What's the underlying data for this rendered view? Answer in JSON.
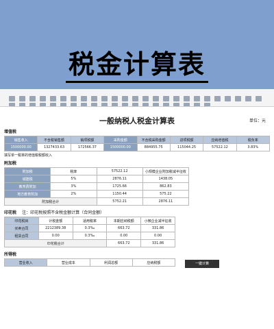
{
  "banner_title": "税金计算表",
  "sheet": {
    "title": "一般纳税人税金计算表",
    "unit": "单位：元",
    "vat": {
      "section": "增值税",
      "headers": [
        "销售收入",
        "不含税销售额",
        "销项税额",
        "采购金额",
        "不含税采购金额",
        "进项税额",
        "应纳增值税",
        "税负率"
      ],
      "values": [
        "1500000.00",
        "1327433.63",
        "172566.37",
        "1500000.00",
        "884955.75",
        "115044.25",
        "57522.12",
        "3.83%"
      ],
      "note": "填写单一税率的增值税税额收入"
    },
    "surcharge": {
      "section": "附加税",
      "headers": [
        "附加税",
        "税率",
        "57522.12",
        "小规模企业附加税减半征收"
      ],
      "rows": [
        [
          "城建税",
          "5%",
          "2876.11",
          "1438.05"
        ],
        [
          "教育费附加",
          "3%",
          "1725.66",
          "862.83"
        ],
        [
          "地方教育附加",
          "2%",
          "1150.44",
          "575.22"
        ]
      ],
      "total_label": "附加税合计",
      "total_values": [
        "5752.21",
        "2876.11"
      ]
    },
    "stamp": {
      "section": "印花税",
      "note": "注：印花税按照不含税金额计算（合同金额）",
      "headers": [
        "印花税目",
        "计税金额",
        "适用税率",
        "本期应纳税额",
        "小微企业减半征收"
      ],
      "rows": [
        [
          "买卖合同",
          "2212389.38",
          "0.3‰",
          "663.72",
          "331.86"
        ],
        [
          "租赁合同",
          "0.00",
          "0.3‰",
          "0.00",
          "0.00"
        ]
      ],
      "total_label": "印花税合计",
      "total_values": [
        "663.72",
        "331.86"
      ]
    },
    "income": {
      "section": "所得税",
      "headers": [
        "营业收入",
        "营业成本",
        "利润总额",
        "应纳税额"
      ],
      "button": "一键计算"
    }
  }
}
